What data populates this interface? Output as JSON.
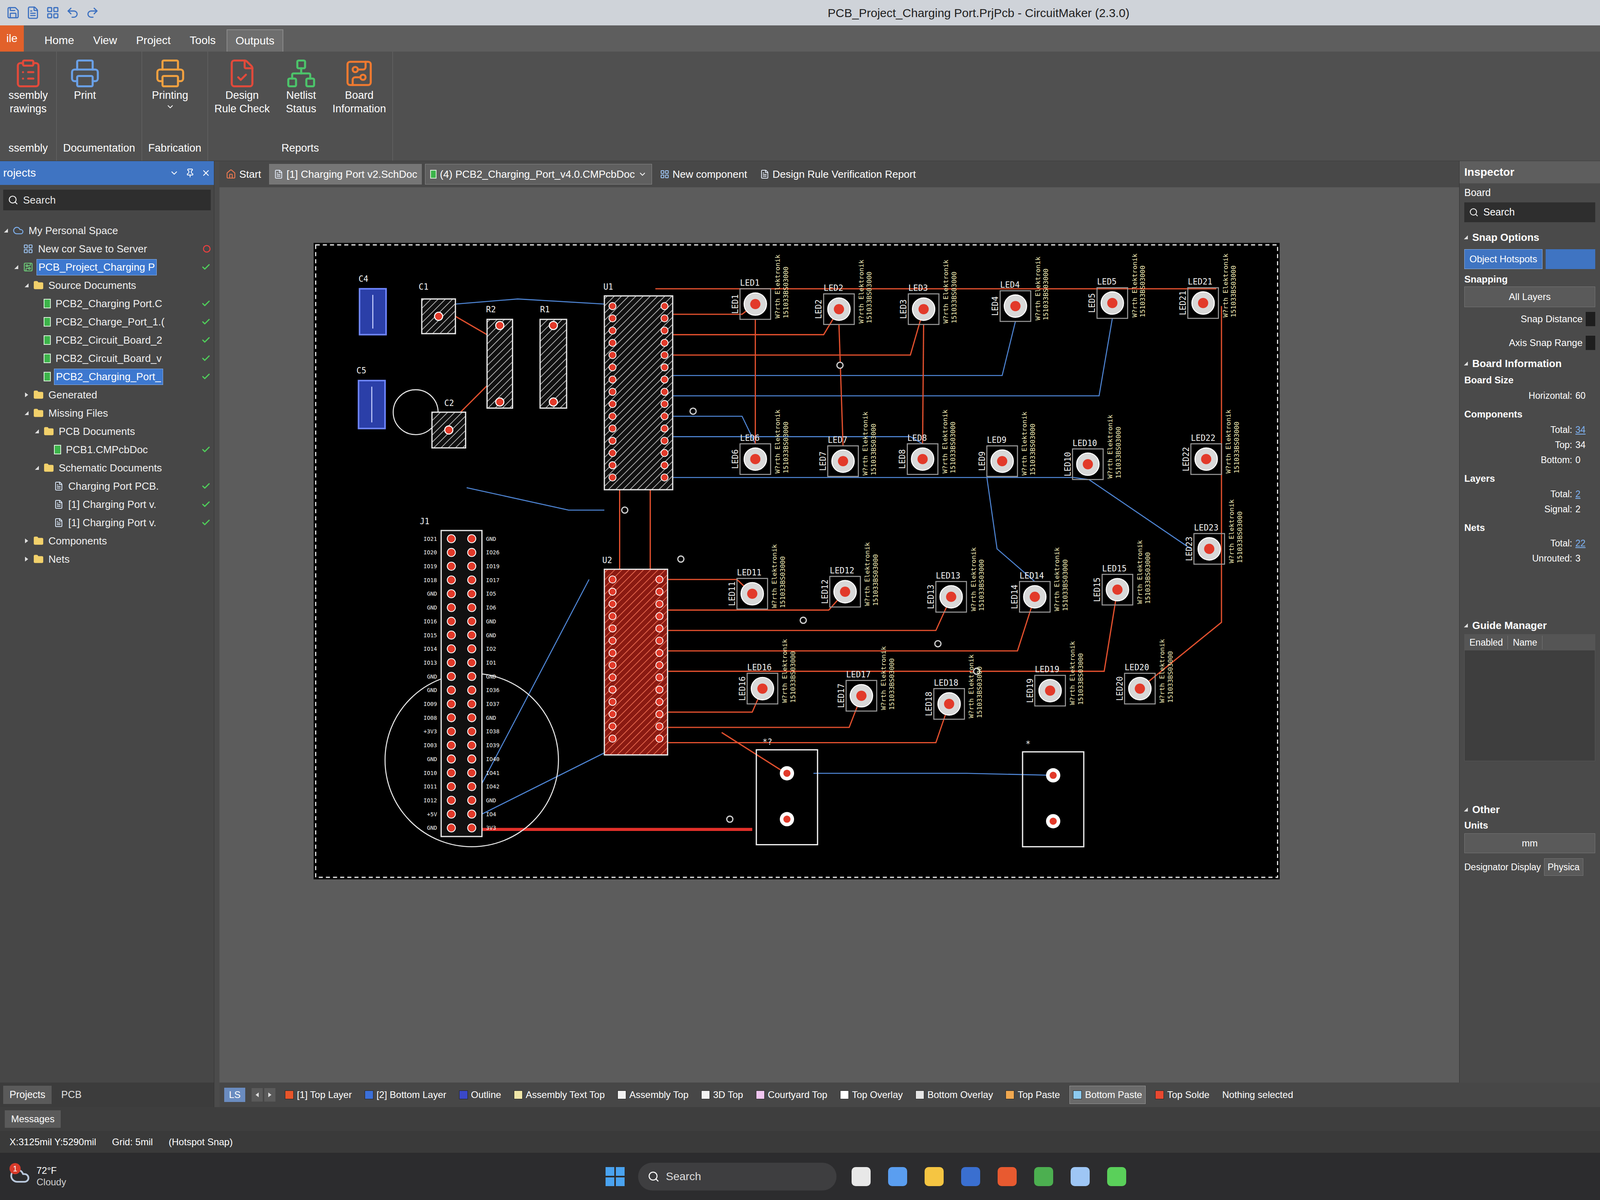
{
  "window": {
    "title": "PCB_Project_Charging Port.PrjPcb - CircuitMaker (2.3.0)"
  },
  "menu_tabs": [
    {
      "label": "ile",
      "selected": false,
      "kind": "file"
    },
    {
      "label": "Home",
      "selected": false,
      "kind": "tab"
    },
    {
      "label": "View",
      "selected": false,
      "kind": "tab"
    },
    {
      "label": "Project",
      "selected": false,
      "kind": "tab"
    },
    {
      "label": "Tools",
      "selected": false,
      "kind": "tab"
    },
    {
      "label": "Outputs",
      "selected": true,
      "kind": "tab"
    }
  ],
  "ribbon": {
    "groups": [
      {
        "label": "ssembly",
        "buttons": [
          {
            "lines": [
              "ssembly",
              "rawings"
            ],
            "dropdown": false
          }
        ]
      },
      {
        "label": "Documentation",
        "buttons": [
          {
            "lines": [
              "Print"
            ],
            "dropdown": false
          }
        ]
      },
      {
        "label": "Fabrication",
        "buttons": [
          {
            "lines": [
              "Printing"
            ],
            "dropdown": true
          }
        ]
      },
      {
        "label": "Reports",
        "buttons": [
          {
            "lines": [
              "Design",
              "Rule Check"
            ],
            "dropdown": false
          },
          {
            "lines": [
              "Netlist",
              "Status"
            ],
            "dropdown": false
          },
          {
            "lines": [
              "Board",
              "Information"
            ],
            "dropdown": false
          }
        ]
      }
    ]
  },
  "doc_tabs": [
    {
      "label": "Start",
      "selected": false,
      "hovered": false,
      "kind": "start"
    },
    {
      "label": "[1] Charging Port v2.SchDoc",
      "selected": false,
      "hovered": true,
      "kind": "sch"
    },
    {
      "label": "(4) PCB2_Charging_Port_v4.0.CMPcbDoc",
      "selected": true,
      "hovered": false,
      "kind": "pcb"
    },
    {
      "label": "New component",
      "selected": false,
      "hovered": false,
      "kind": "comp"
    },
    {
      "label": "Design Rule Verification Report",
      "selected": false,
      "hovered": false,
      "kind": "report"
    }
  ],
  "projects_panel": {
    "title": "rojects",
    "search": "Search",
    "tree": [
      {
        "label": "My Personal Space",
        "level": 0,
        "kind": "space",
        "expanded": true,
        "status": "none",
        "selected": false
      },
      {
        "label": "New cor Save to Server",
        "level": 1,
        "kind": "cloud",
        "expanded": false,
        "status": "error",
        "selected": false
      },
      {
        "label": "PCB_Project_Charging P",
        "level": 1,
        "kind": "project",
        "expanded": true,
        "status": "ok",
        "selected": true
      },
      {
        "label": "Source Documents",
        "level": 2,
        "kind": "folder",
        "expanded": true,
        "status": "none",
        "selected": false
      },
      {
        "label": "PCB2_Charging Port.C",
        "level": 3,
        "kind": "pcbdoc",
        "expanded": false,
        "status": "ok",
        "selected": false
      },
      {
        "label": "PCB2_Charge_Port_1.(",
        "level": 3,
        "kind": "pcbdoc",
        "expanded": false,
        "status": "ok",
        "selected": false
      },
      {
        "label": "PCB2_Circuit_Board_2",
        "level": 3,
        "kind": "pcbdoc",
        "expanded": false,
        "status": "ok",
        "selected": false
      },
      {
        "label": "PCB2_Circuit_Board_v",
        "level": 3,
        "kind": "pcbdoc",
        "expanded": false,
        "status": "ok",
        "selected": false
      },
      {
        "label": "PCB2_Charging_Port_",
        "level": 3,
        "kind": "pcbdoc",
        "expanded": false,
        "status": "ok",
        "selected": true
      },
      {
        "label": "Generated",
        "level": 2,
        "kind": "folder",
        "expanded": false,
        "status": "none",
        "selected": false
      },
      {
        "label": "Missing Files",
        "level": 2,
        "kind": "folder",
        "expanded": true,
        "status": "none",
        "selected": false
      },
      {
        "label": "PCB Documents",
        "level": 3,
        "kind": "folder",
        "expanded": true,
        "status": "none",
        "selected": false
      },
      {
        "label": "PCB1.CMPcbDoc",
        "level": 4,
        "kind": "pcbdoc",
        "expanded": false,
        "status": "ok",
        "selected": false
      },
      {
        "label": "Schematic Documents",
        "level": 3,
        "kind": "folder",
        "expanded": true,
        "status": "none",
        "selected": false
      },
      {
        "label": "Charging Port PCB.",
        "level": 4,
        "kind": "schdoc",
        "expanded": false,
        "status": "ok",
        "selected": false
      },
      {
        "label": "[1] Charging Port v.",
        "level": 4,
        "kind": "schdoc",
        "expanded": false,
        "status": "ok",
        "selected": false
      },
      {
        "label": "[1] Charging Port v.",
        "level": 4,
        "kind": "schdoc",
        "expanded": false,
        "status": "ok",
        "selected": false
      },
      {
        "label": "Components",
        "level": 2,
        "kind": "folder",
        "expanded": false,
        "status": "none",
        "selected": false
      },
      {
        "label": "Nets",
        "level": 2,
        "kind": "folder",
        "expanded": false,
        "status": "none",
        "selected": false
      }
    ],
    "bottom_tabs": [
      {
        "label": "Projects",
        "selected": true
      },
      {
        "label": "PCB",
        "selected": false
      }
    ]
  },
  "pcb": {
    "parts": [
      {
        "designator": "C4",
        "kind": "cap_smd"
      },
      {
        "designator": "C5",
        "kind": "cap_smd"
      },
      {
        "designator": "C1",
        "kind": "cap_tht"
      },
      {
        "designator": "C2",
        "kind": "cap_el"
      },
      {
        "designator": "R2",
        "kind": "res"
      },
      {
        "designator": "R1",
        "kind": "res"
      },
      {
        "designator": "U1",
        "kind": "ic"
      },
      {
        "designator": "U2",
        "kind": "ic_red"
      }
    ],
    "led_value": [
      "W?rth Elektronik",
      "151033BS03000"
    ],
    "leds": [
      {
        "designator": "LED1"
      },
      {
        "designator": "LED2"
      },
      {
        "designator": "LED3"
      },
      {
        "designator": "LED4"
      },
      {
        "designator": "LED5"
      },
      {
        "designator": "LED21"
      },
      {
        "designator": "LED6"
      },
      {
        "designator": "LED7"
      },
      {
        "designator": "LED8"
      },
      {
        "designator": "LED9"
      },
      {
        "designator": "LED10"
      },
      {
        "designator": "LED22"
      },
      {
        "designator": "LED23"
      },
      {
        "designator": "LED11"
      },
      {
        "designator": "LED12"
      },
      {
        "designator": "LED13"
      },
      {
        "designator": "LED14"
      },
      {
        "designator": "LED15"
      },
      {
        "designator": "LED16"
      },
      {
        "designator": "LED17"
      },
      {
        "designator": "LED18"
      },
      {
        "designator": "LED19"
      },
      {
        "designator": "LED20"
      }
    ],
    "header": {
      "designator": "J1",
      "left_pins": [
        "IO21",
        "IO20",
        "IO19",
        "IO18",
        "GND",
        "GND",
        "IO16",
        "IO15",
        "IO14",
        "IO13",
        "GND",
        "GND",
        "IO09",
        "IO08",
        "+3V3",
        "IO03",
        "GND",
        "IO10",
        "IO11",
        "IO12",
        "+5V",
        "GND"
      ],
      "right_pins": [
        "GND",
        "IO26",
        "IO19",
        "IO17",
        "IO5",
        "IO6",
        "GND",
        "GND",
        "IO2",
        "IO1",
        "GND",
        "IO36",
        "IO37",
        "GND",
        "IO38",
        "IO39",
        "IO40",
        "IO41",
        "IO42",
        "GND",
        "IO4",
        "3V3"
      ]
    },
    "connectors": [
      {
        "designator": "*?"
      },
      {
        "designator": "*"
      }
    ]
  },
  "inspector": {
    "title": "Inspector",
    "object": "Board",
    "search": "Search",
    "snap_options": {
      "title": "Snap Options",
      "buttons": [
        {
          "label": "Object Hotspots",
          "selected": true
        }
      ],
      "snapping_label": "Snapping",
      "snapping_value": "All Layers",
      "rows": [
        "Snap Distance",
        "Axis Snap Range"
      ]
    },
    "board_information": {
      "title": "Board Information",
      "groups": [
        {
          "label": "Board Size",
          "rows": [
            {
              "label": "Horizontal:",
              "value": "60",
              "link": false
            }
          ]
        },
        {
          "label": "Components",
          "rows": [
            {
              "label": "Total:",
              "value": "34",
              "link": true
            },
            {
              "label": "Top:",
              "value": "34",
              "link": false
            },
            {
              "label": "Bottom:",
              "value": "0",
              "link": false
            }
          ]
        },
        {
          "label": "Layers",
          "rows": [
            {
              "label": "Total:",
              "value": "2",
              "link": true
            },
            {
              "label": "Signal:",
              "value": "2",
              "link": false
            }
          ]
        },
        {
          "label": "Nets",
          "rows": [
            {
              "label": "Total:",
              "value": "22",
              "link": true
            },
            {
              "label": "Unrouted:",
              "value": "3",
              "link": false
            }
          ]
        }
      ]
    },
    "guide_manager": {
      "title": "Guide Manager",
      "columns": [
        "Enabled",
        "Name"
      ]
    },
    "other": {
      "title": "Other",
      "units_label": "Units",
      "units_value": "mm",
      "designator_label": "Designator Display",
      "designator_value": "Physica"
    }
  },
  "layer_bar": {
    "ls": "LS",
    "layers": [
      {
        "label": "[1] Top Layer",
        "color": "#e8552a",
        "selected": false
      },
      {
        "label": "[2] Bottom Layer",
        "color": "#3b6fd8",
        "selected": false
      },
      {
        "label": "Outline",
        "color": "#3a48c8",
        "selected": false
      },
      {
        "label": "Assembly Text Top",
        "color": "#efe6a8",
        "selected": false
      },
      {
        "label": "Assembly Top",
        "color": "#f2f2f2",
        "selected": false
      },
      {
        "label": "3D Top",
        "color": "#f2f2f2",
        "selected": false
      },
      {
        "label": "Courtyard Top",
        "color": "#f0c6f0",
        "selected": false
      },
      {
        "label": "Top Overlay",
        "color": "#ffffff",
        "selected": false
      },
      {
        "label": "Bottom Overlay",
        "color": "#e6e6e6",
        "selected": false
      },
      {
        "label": "Top Paste",
        "color": "#f0a850",
        "selected": false
      },
      {
        "label": "Bottom Paste",
        "color": "#8ccaf0",
        "selected": true
      },
      {
        "label": "Top Solde",
        "color": "#e84830",
        "selected": false
      }
    ],
    "selection": "Nothing selected"
  },
  "messages": "Messages",
  "status_bar": [
    "X:3125mil Y:5290mil",
    "Grid: 5mil",
    "(Hotspot Snap)"
  ],
  "taskbar": {
    "weather": {
      "badge": "1",
      "temp": "72°F",
      "condition": "Cloudy"
    },
    "search": "Search"
  }
}
